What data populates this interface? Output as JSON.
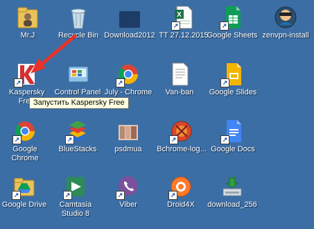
{
  "desktop": {
    "icons": [
      {
        "label": "Mr.J"
      },
      {
        "label": "Recycle Bin"
      },
      {
        "label": "Download2012"
      },
      {
        "label": "TT 27.12.2015"
      },
      {
        "label": "Google Sheets"
      },
      {
        "label": "zenvpn-install"
      },
      {
        "label": "Kaspersky Free"
      },
      {
        "label": "Control Panel"
      },
      {
        "label": "July - Chrome"
      },
      {
        "label": "Van-ban"
      },
      {
        "label": "Google Slides"
      },
      {
        "label": "Google Chrome"
      },
      {
        "label": "BlueStacks"
      },
      {
        "label": "psdmua"
      },
      {
        "label": "Bchrome-log..."
      },
      {
        "label": "Google Docs"
      },
      {
        "label": "Google Drive"
      },
      {
        "label": "Camtasia Studio 8"
      },
      {
        "label": "Viber"
      },
      {
        "label": "Droid4X"
      },
      {
        "label": "download_256"
      }
    ],
    "tooltip": "Запустить Kaspersky Free"
  },
  "colors": {
    "desktop_bg": "#3b6ea5",
    "arrow": "#e8322a",
    "tooltip_bg": "#ffffe1"
  }
}
